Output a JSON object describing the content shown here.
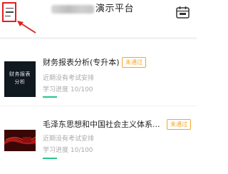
{
  "header": {
    "title": "演示平台",
    "menu_icon": "menu-icon",
    "calendar_icon": "calendar-icon"
  },
  "courses": [
    {
      "title": "财务报表分析(专升本)",
      "thumbnail_text": [
        "财务报表",
        "分析"
      ],
      "status_badge": "未通过",
      "exam_note": "近期没有考试安排",
      "progress_text": "学习进度 10/100",
      "progress": 0.1
    },
    {
      "title": "毛泽东思想和中国社会主义体系...",
      "status_badge": "未通过",
      "exam_note": "近期没有考试安排",
      "progress_text": "学习进度 10/100",
      "progress": 0.1
    }
  ],
  "colors": {
    "accent": "#2bc48a",
    "badge": "#f5a623",
    "highlight": "#e02020"
  }
}
